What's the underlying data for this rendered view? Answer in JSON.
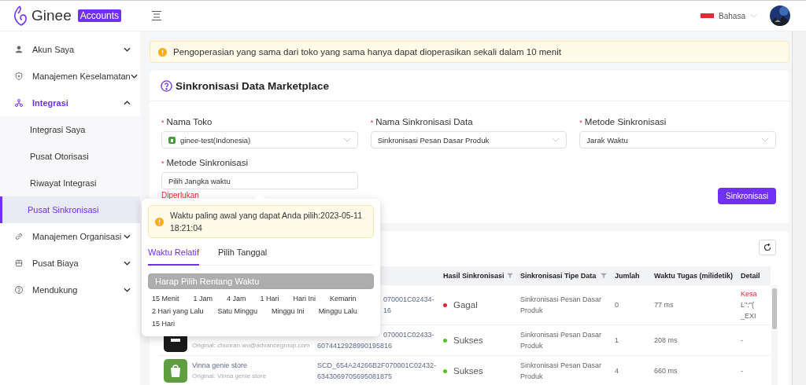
{
  "header": {
    "logo_text": "Ginee",
    "logo_badge": "Accounts",
    "language": "Bahasa"
  },
  "sidebar": {
    "items": [
      {
        "label": "Akun Saya",
        "kind": "user",
        "expanded": false,
        "selected": false
      },
      {
        "label": "Manajemen Keselamatan",
        "kind": "shield",
        "expanded": false,
        "selected": false
      },
      {
        "label": "Integrasi",
        "kind": "network",
        "expanded": true,
        "selected": true,
        "children": [
          {
            "label": "Integrasi Saya",
            "selected": false
          },
          {
            "label": "Pusat Otorisasi",
            "selected": false
          },
          {
            "label": "Riwayat Integrasi",
            "selected": false
          },
          {
            "label": "Pusat Sinkronisasi",
            "selected": true
          }
        ]
      },
      {
        "label": "Manajemen Organisasi",
        "kind": "link",
        "expanded": false,
        "selected": false
      },
      {
        "label": "Pusat Biaya",
        "kind": "wallet",
        "expanded": false,
        "selected": false
      },
      {
        "label": "Mendukung",
        "kind": "help",
        "expanded": false,
        "selected": false
      }
    ]
  },
  "notice": "Pengoperasian yang sama dari toko yang sama hanya dapat dioperasikan sekali dalam 10 menit",
  "sync_card": {
    "title": "Sinkronisasi Data Marketplace",
    "fields": [
      {
        "mark": "*",
        "label": "Nama Toko",
        "kind": "shop_select",
        "value": "ginee-test(Indonesia)"
      },
      {
        "mark": "*",
        "label": "Nama Sinkronisasi Data",
        "kind": "select",
        "value": "Sinkronisasi Pesan Dasar Produk"
      },
      {
        "mark": "*",
        "label": "Metode Sinkronisasi",
        "kind": "select",
        "value": "Jarak Waktu"
      },
      {
        "mark": "*",
        "label": "Metode Sinkronisasi",
        "kind": "input",
        "value": "Pilih Jangka waktu",
        "error": "Diperlukan"
      }
    ],
    "button": "Sinkronisasi"
  },
  "popover": {
    "notice": "Waktu paling awal yang dapat Anda pilih:2023-05-11 18:21:04",
    "tabs": [
      {
        "label": "Waktu Relatif",
        "selected": true
      },
      {
        "label": "Pilih Tanggal",
        "selected": false
      }
    ],
    "range": {
      "placeholder": "Harap Pilih Rentang Waktu",
      "disabled": true
    },
    "options": [
      "15 Menit",
      "1 Jam",
      "4 Jam",
      "1 Hari",
      "Hari Ini",
      "Kemarin",
      "2 Hari yang Lalu",
      "Satu Minggu",
      "Minggu Ini",
      "Minggu Lalu",
      "15 Hari"
    ]
  },
  "table": {
    "columns": [
      {
        "label": "Hasil Sinkronisasi",
        "filter": true
      },
      {
        "label": "Sinkronisasi Tipe Data",
        "filter": true
      },
      {
        "label": "Jumlah"
      },
      {
        "label": "Waktu Tugas (milidetik)"
      },
      {
        "label": "Detail"
      }
    ],
    "rows": [
      {
        "id_lines": [
          {
            "text": "070001C02434-",
            "covered": true
          },
          {
            "text": "16",
            "covered": true
          }
        ],
        "result": "Gagal",
        "color": "#e8262d",
        "type": "Sinkronisasi Pesan Dasar Produk",
        "count": "0",
        "time": "77 ms",
        "detail_lines": [
          {
            "text": "Kesa",
            "error": true
          },
          {
            "text": "L\":\"(",
            "error": false
          },
          {
            "text": "_EXI",
            "error": false
          }
        ]
      },
      {
        "store": {
          "kind": "dark",
          "original": "Original: chunran.wu@advancegroup.com"
        },
        "id_lines": [
          {
            "text": "070001C02433-",
            "covered": true
          },
          {
            "text": "6074412928990195816",
            "covered": false
          }
        ],
        "result": "Sukses",
        "color": "#52c41a",
        "type": "Sinkronisasi Pesan Dasar Produk",
        "count": "1",
        "time": "208 ms",
        "detail_lines": [
          {
            "text": "-",
            "error": false
          }
        ]
      },
      {
        "store": {
          "kind": "bag",
          "name": "Vinna genie store",
          "original": "Original: Vinna genie store"
        },
        "id_lines": [
          {
            "text": "SCD_654A24266B2F070001C02432-",
            "covered": false
          },
          {
            "text": "6343069705695081875",
            "covered": false
          }
        ],
        "result": "Sukses",
        "color": "#52c41a",
        "type": "Sinkronisasi Pesan Dasar Produk",
        "count": "4",
        "time": "660 ms",
        "detail_lines": [
          {
            "text": "-",
            "error": false
          }
        ]
      }
    ]
  }
}
